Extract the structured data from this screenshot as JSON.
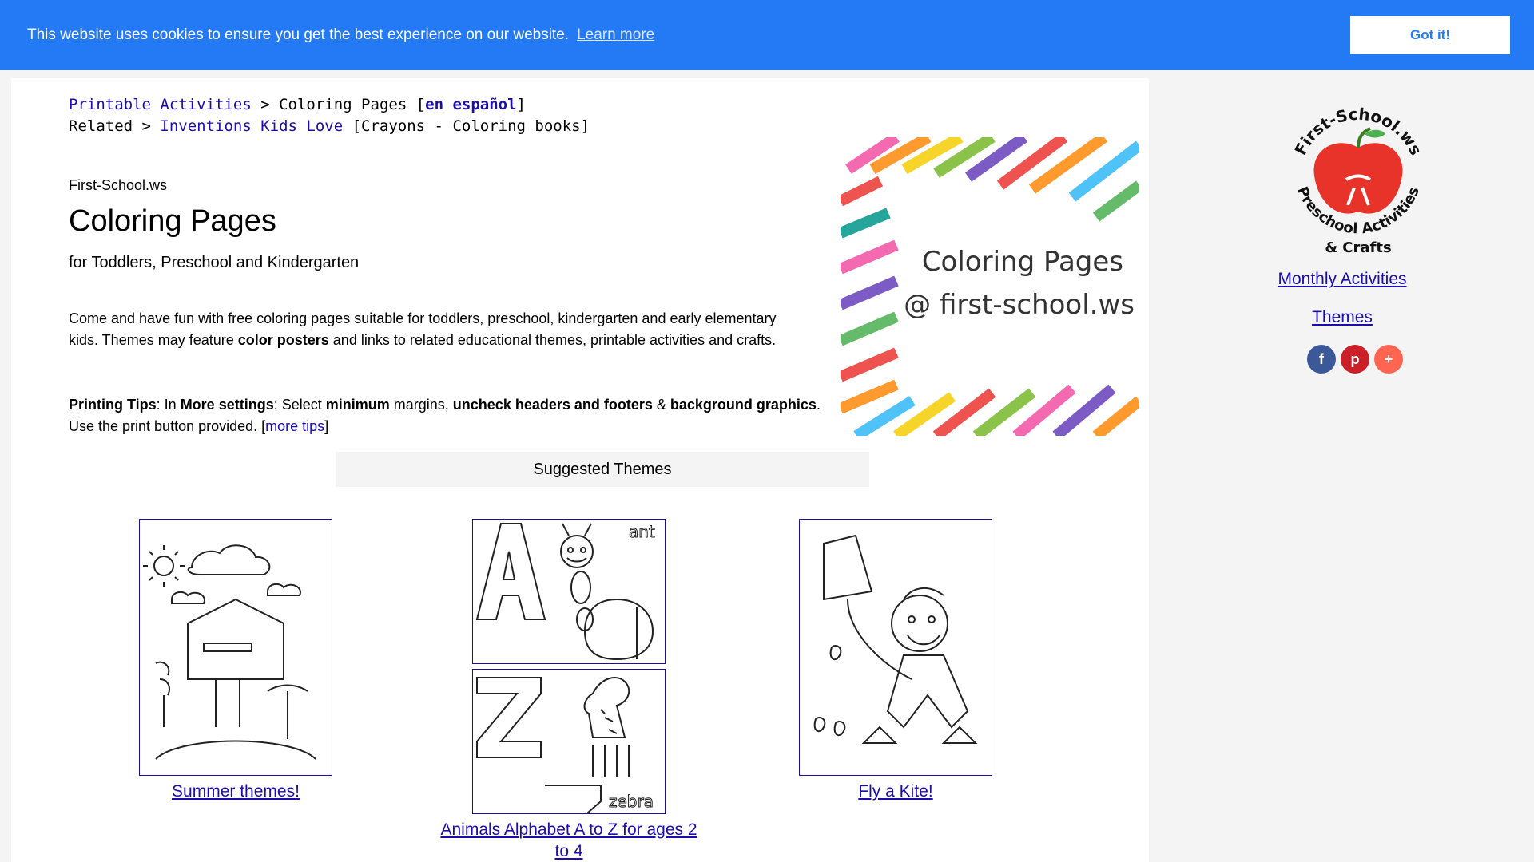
{
  "cookie": {
    "message": "This website uses cookies to ensure you get the best experience on our website.",
    "learn_more": "Learn more",
    "accept": "Got it!",
    "bg_color": "#2479f5"
  },
  "breadcrumb": {
    "root": "Printable Activities",
    "sep": " > ",
    "current": "Coloring Pages [",
    "spanish": "en español",
    "close": "]",
    "related_prefix": "Related > ",
    "related_link": "Inventions Kids Love",
    "related_suffix": " [Crayons - Coloring books]"
  },
  "header": {
    "site": "First-School.ws",
    "title": "Coloring Pages",
    "subtitle": "for Toddlers, Preschool and Kindergarten"
  },
  "intro": {
    "part1": "Come and have fun with free coloring pages suitable for toddlers, preschool, kindergarten and early elementary kids. Themes may feature ",
    "bold": "color posters",
    "part2": " and links to related educational themes, printable activities and crafts."
  },
  "tips": {
    "label": "Printing Tips",
    "t1": ": In ",
    "b1": "More settings",
    "t2": ": Select ",
    "b2": "minimum",
    "t3": " margins, ",
    "b3": "uncheck headers and footers",
    "t4": " & ",
    "b4": "background graphics",
    "t5": ". Use the print button provided. [",
    "link": "more tips",
    "t6": "]"
  },
  "hero": {
    "caption_line1": "Coloring Pages",
    "caption_line2": "@ first-school.ws"
  },
  "suggested": {
    "heading": "Suggested Themes"
  },
  "themes": [
    {
      "label": "Summer themes!"
    },
    {
      "label": "Animals Alphabet A to Z for ages 2 to 4",
      "top_word": "ant",
      "bottom_word": "zebra"
    },
    {
      "label": "Fly a Kite!"
    }
  ],
  "sidebar": {
    "logo_top": "First-School.ws",
    "logo_bottom1": "Preschool Activities",
    "logo_bottom2": "& Crafts",
    "monthly": "Monthly Activities",
    "themes": "Themes",
    "social": [
      {
        "icon": "facebook-icon",
        "glyph": "f",
        "color": "#3b5998"
      },
      {
        "icon": "pinterest-icon",
        "glyph": "p",
        "color": "#cb2027"
      },
      {
        "icon": "share-icon",
        "glyph": "+",
        "color": "#ff6550"
      }
    ]
  }
}
